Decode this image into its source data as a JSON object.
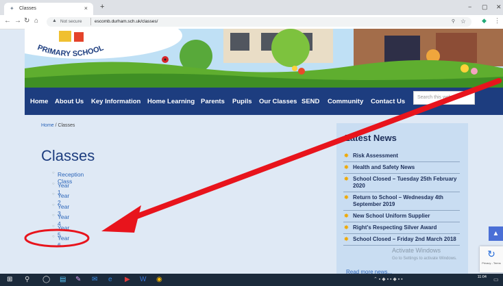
{
  "browser": {
    "tab_title": "Classes",
    "tab_close": "×",
    "new_tab": "+",
    "address_warning": "Not secure",
    "url": "escomb.durham.sch.uk/classes/"
  },
  "site": {
    "logo_text": "PRIMARY SCHOOL",
    "nav": [
      "Home",
      "About Us",
      "Key Information",
      "Home Learning",
      "Parents",
      "Pupils",
      "Our Classes",
      "SEND",
      "Community",
      "Contact Us"
    ],
    "search_placeholder": "Search this website"
  },
  "page": {
    "breadcrumb_home": "Home",
    "breadcrumb_sep": " / ",
    "breadcrumb_current": "Classes",
    "title": "Classes",
    "classes": [
      "Reception Class",
      "Year 1",
      "Year 2",
      "Year 3",
      "Year 4",
      "Year 5",
      "Year 6"
    ]
  },
  "news": {
    "heading": "Latest News",
    "items": [
      "Risk Assessment",
      "Health and Safety News",
      "School Closed – Tuesday 25th February 2020",
      "Return to School – Wednesday 4th September 2019",
      "New School Uniform Supplier",
      "Right's Respecting Silver Award",
      "School Closed – Friday 2nd March 2018"
    ],
    "read_more": "Read more news..."
  },
  "overlay": {
    "activate_title": "Activate Windows",
    "activate_sub": "Go to Settings to activate Windows.",
    "recaptcha_text": "Privacy - Terms"
  },
  "taskbar": {
    "time": "11:04"
  },
  "colors": {
    "nav_bg": "#1d3d7f",
    "sidebar_bg": "#c9ddf2",
    "annotation_red": "#e8141c"
  }
}
